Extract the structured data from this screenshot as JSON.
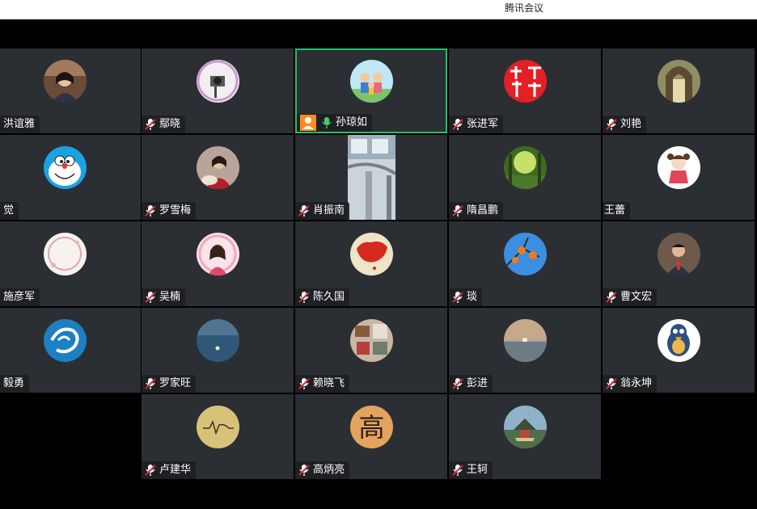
{
  "app": {
    "title": "腾讯会议"
  },
  "colors": {
    "tile_bg": "#2b2f33",
    "active_border": "#21c16a",
    "muted_mic": "#d0303a",
    "live_mic": "#3fd16a",
    "share_badge": "#ff8a1f"
  },
  "participants": [
    {
      "name": "洪谊雅",
      "mic": "none",
      "avatar": "photo-woman"
    },
    {
      "name": "鄢晓",
      "mic": "muted",
      "avatar": "photo-camera"
    },
    {
      "name": "孙琼如",
      "mic": "live",
      "avatar": "cartoon-family",
      "share": true,
      "active": true
    },
    {
      "name": "张进军",
      "mic": "muted",
      "avatar": "red-calligraphy"
    },
    {
      "name": "刘艳",
      "mic": "muted",
      "avatar": "photo-arch"
    },
    {
      "name": "觉",
      "mic": "none",
      "avatar": "cartoon-doraemon"
    },
    {
      "name": "罗雪梅",
      "mic": "muted",
      "avatar": "photo-woman-red"
    },
    {
      "name": "肖振南",
      "mic": "muted",
      "avatar": "video-feed"
    },
    {
      "name": "隋昌鹏",
      "mic": "muted",
      "avatar": "photo-forest"
    },
    {
      "name": "王蕾",
      "mic": "none",
      "avatar": "cartoon-girl"
    },
    {
      "name": "施彦军",
      "mic": "none",
      "avatar": "white-floral"
    },
    {
      "name": "吴楠",
      "mic": "muted",
      "avatar": "photo-woman-pink"
    },
    {
      "name": "陈久国",
      "mic": "muted",
      "avatar": "china-map"
    },
    {
      "name": "琰",
      "mic": "muted",
      "avatar": "persimmon-sky"
    },
    {
      "name": "曹文宏",
      "mic": "muted",
      "avatar": "photo-man"
    },
    {
      "name": "毅勇",
      "mic": "none",
      "avatar": "blue-dragon"
    },
    {
      "name": "罗家旺",
      "mic": "muted",
      "avatar": "moon-sky"
    },
    {
      "name": "赖晓飞",
      "mic": "muted",
      "avatar": "photo-collage"
    },
    {
      "name": "彭进",
      "mic": "muted",
      "avatar": "sunset-lake"
    },
    {
      "name": "翁永坤",
      "mic": "muted",
      "avatar": "cartoon-bird"
    },
    {
      "name": "卢建华",
      "mic": "muted",
      "avatar": "gold-signature"
    },
    {
      "name": "高炳亮",
      "mic": "muted",
      "avatar": "calligraphy-gao"
    },
    {
      "name": "王轲",
      "mic": "muted",
      "avatar": "photo-pagoda"
    }
  ],
  "avatar_text": {
    "gao": "高"
  }
}
